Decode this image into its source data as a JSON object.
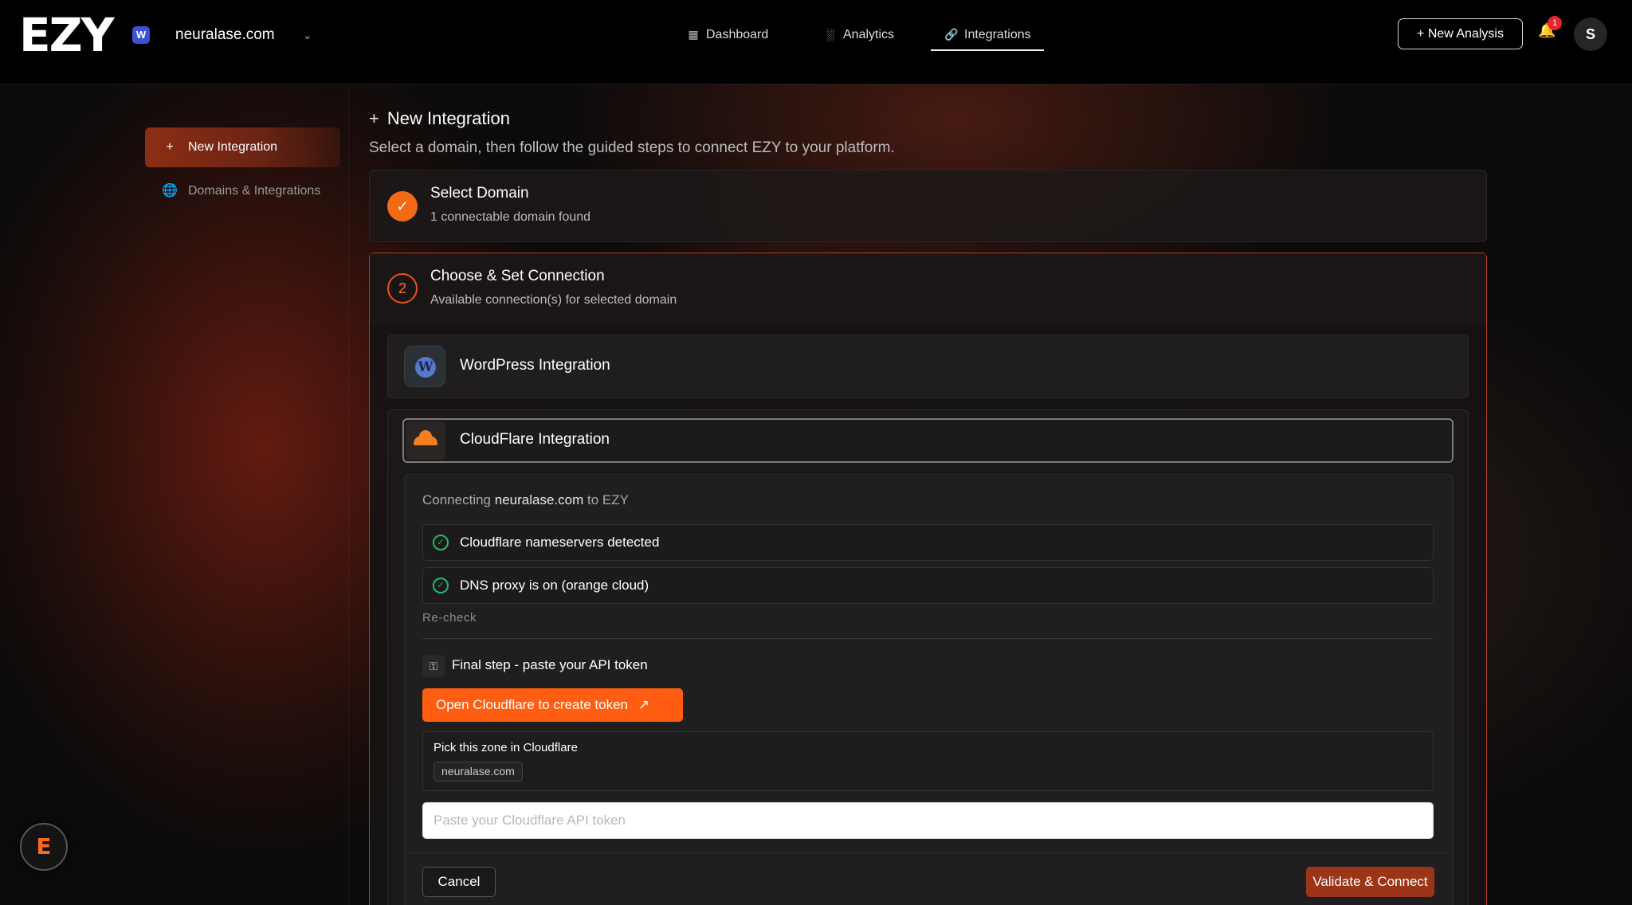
{
  "app": {
    "logo_text": "EZY",
    "site_badge": "W",
    "current_domain": "neuralase.com"
  },
  "nav": {
    "items": [
      {
        "label": "Dashboard",
        "icon": "grid-icon"
      },
      {
        "label": "Analytics",
        "icon": "bar-chart-icon"
      },
      {
        "label": "Integrations",
        "icon": "link-icon",
        "active": true
      }
    ]
  },
  "header": {
    "new_analysis_label": "New Analysis",
    "notification_count": "1",
    "avatar_initial": "S"
  },
  "sidebar": {
    "items": [
      {
        "label": "New Integration",
        "icon": "plus-icon",
        "active": true
      },
      {
        "label": "Domains & Integrations",
        "icon": "globe-icon",
        "active": false
      }
    ]
  },
  "main": {
    "title": "New Integration",
    "subtitle": "Select a domain, then follow the guided steps to connect EZY to your platform."
  },
  "steps": {
    "step1": {
      "title": "Select Domain",
      "subtitle": "1 connectable domain found",
      "status": "complete"
    },
    "step2": {
      "number": "2",
      "title": "Choose & Set Connection",
      "subtitle": "Available connection(s) for selected domain"
    }
  },
  "integrations": {
    "wordpress": {
      "title": "WordPress Integration"
    },
    "cloudflare": {
      "title": "CloudFlare Integration",
      "connecting_prefix": "Connecting",
      "connecting_domain": "neuralase.com",
      "connecting_suffix": "to EZY",
      "checks": [
        {
          "label": "Cloudflare nameservers detected",
          "status": "ok"
        },
        {
          "label": "DNS proxy is on (orange cloud)",
          "status": "ok"
        }
      ],
      "recheck_label": "Re-check",
      "final_step_label": "Final step - paste your API token",
      "open_cf_label": "Open Cloudflare to create token",
      "zone_label": "Pick this zone in Cloudflare",
      "zone_value": "neuralase.com",
      "token_placeholder": "Paste your Cloudflare API token",
      "token_value": "",
      "cancel_label": "Cancel",
      "validate_label": "Validate & Connect"
    }
  },
  "colors": {
    "accent": "#ff5d12",
    "step_border": "#b53a1e",
    "success": "#25b86b",
    "validate_bg": "#9c3417"
  }
}
